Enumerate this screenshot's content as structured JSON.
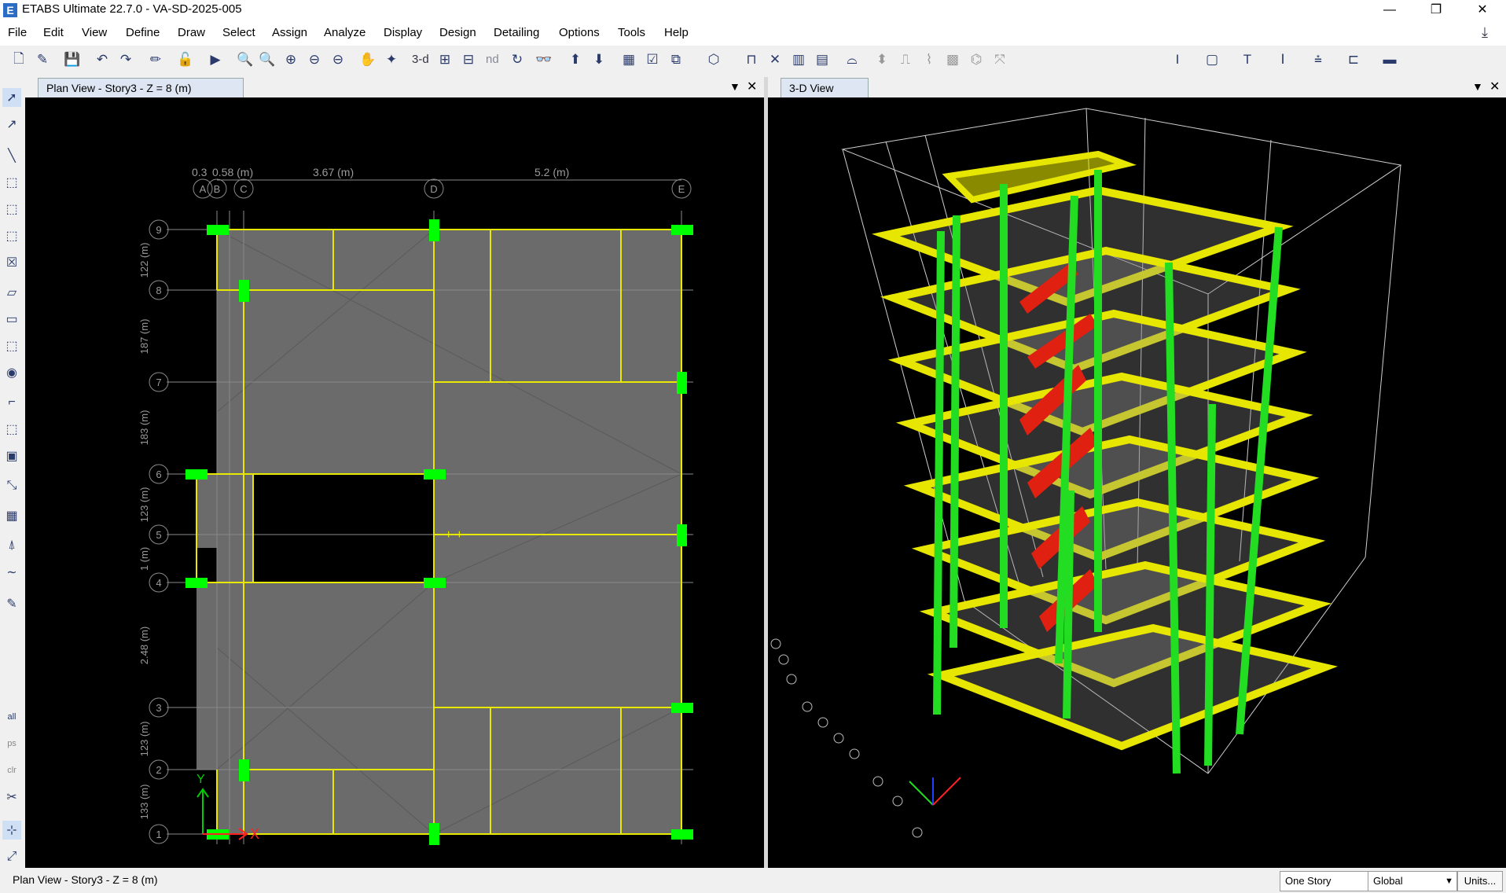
{
  "window": {
    "title": "ETABS Ultimate 22.7.0 - VA-SD-2025-005",
    "app_icon_letter": "E",
    "minimize": "—",
    "restore": "❐",
    "close": "✕"
  },
  "menu": [
    "File",
    "Edit",
    "View",
    "Define",
    "Draw",
    "Select",
    "Assign",
    "Analyze",
    "Display",
    "Design",
    "Detailing",
    "Options",
    "Tools",
    "Help"
  ],
  "toolbar": {
    "text_buttons": [
      "3-d",
      "nd"
    ]
  },
  "plan_view": {
    "tab_title": "Plan View - Story3 - Z = 8 (m)",
    "dim_top": [
      "0.3",
      "0.58 (m)",
      "3.67 (m)",
      "5.2 (m)"
    ],
    "grid_columns": [
      "A",
      "B",
      "C",
      "D",
      "E"
    ],
    "grid_rows": [
      "9",
      "8",
      "7",
      "6",
      "5",
      "4",
      "3",
      "2",
      "1"
    ],
    "dim_left": [
      "122 (m)",
      "187 (m)",
      "183 (m)",
      "123 (m)",
      "1 (m)",
      "2.48 (m)",
      "123 (m)",
      "133 (m)"
    ],
    "colors": {
      "slab": "#6e6e6e",
      "beam": "#e8e800",
      "column": "#00ff00",
      "axis_x": "#ff2020",
      "axis_y": "#00cc00"
    }
  },
  "view_3d": {
    "tab_title": "3-D View",
    "colors": {
      "beam": "#e6e600",
      "column": "#22dd22",
      "stair": "#e02010",
      "grid": "#cfcfcf"
    }
  },
  "status": {
    "text": "Plan View - Story3 - Z = 8 (m)",
    "story_combo": "One Story",
    "coord_combo": "Global",
    "units_button": "Units..."
  },
  "left_toolbar": {
    "labels": [
      "all",
      "ps",
      "clr"
    ]
  }
}
